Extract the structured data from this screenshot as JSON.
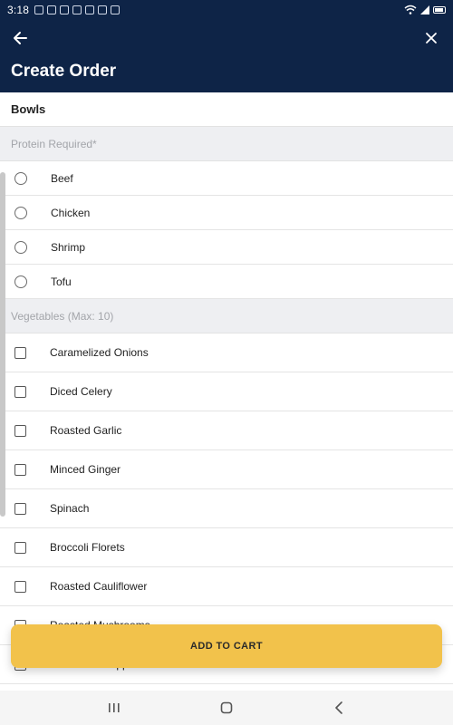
{
  "status_bar": {
    "time": "3:18"
  },
  "app_bar": {
    "title": "Create Order"
  },
  "section": {
    "title": "Bowls"
  },
  "protein_group": {
    "header": "Protein Required*",
    "options": [
      {
        "label": "Beef"
      },
      {
        "label": "Chicken"
      },
      {
        "label": "Shrimp"
      },
      {
        "label": "Tofu"
      }
    ]
  },
  "vegetables_group": {
    "header": "Vegetables (Max: 10)",
    "options": [
      {
        "label": "Caramelized Onions"
      },
      {
        "label": "Diced Celery"
      },
      {
        "label": "Roasted Garlic"
      },
      {
        "label": "Minced Ginger"
      },
      {
        "label": "Spinach"
      },
      {
        "label": "Broccoli Florets"
      },
      {
        "label": "Roasted Cauliflower"
      },
      {
        "label": "Roasted Mushrooms"
      },
      {
        "label": "Mixed Bell Peppers"
      }
    ]
  },
  "cta": {
    "label": "ADD TO CART"
  },
  "icons": {
    "back": "arrow-left-icon",
    "close": "close-icon",
    "nav_recents": "recents-icon",
    "nav_home": "home-icon",
    "nav_back": "nav-back-icon"
  },
  "colors": {
    "header_bg": "#0e2447",
    "accent": "#f2c24b"
  }
}
